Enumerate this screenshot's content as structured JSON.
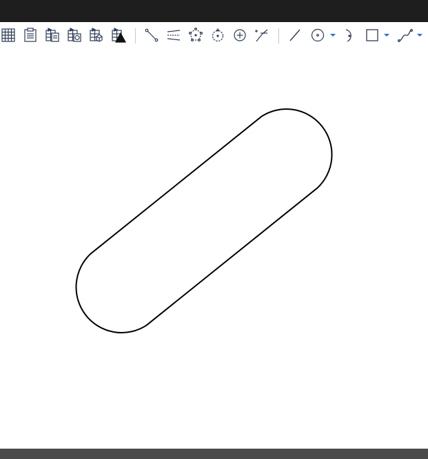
{
  "window": {
    "title": ""
  },
  "toolbar": {
    "groups": [
      {
        "name": "sketch-constraints-tools",
        "icons": [
          "grid-icon",
          "sketch-list-icon",
          "sketch-edit-icon",
          "sketch-map-icon",
          "sketch-validate-icon",
          "sketch-solid-icon"
        ]
      },
      {
        "name": "constraint-tools",
        "icons": [
          "coincident-icon",
          "construction-lines-icon",
          "polygon-points-icon",
          "circle-point-icon",
          "crosshair-circle-icon",
          "trim-icon"
        ]
      },
      {
        "name": "geometry-tools",
        "icons": [
          "line-icon",
          "circle-icon",
          "arc-icon",
          "rectangle-icon",
          "bspline-icon"
        ]
      }
    ]
  },
  "colors": {
    "titlebar": "#1e1e1e",
    "statusbar": "#4a4a4a",
    "icon_stroke": "#2b3a55",
    "dropdown_arrow": "#2d6fd0",
    "sketch_stroke": "#000000",
    "canvas_bg": "#ffffff"
  },
  "sketch": {
    "shape": "slot",
    "description_visible": false
  }
}
